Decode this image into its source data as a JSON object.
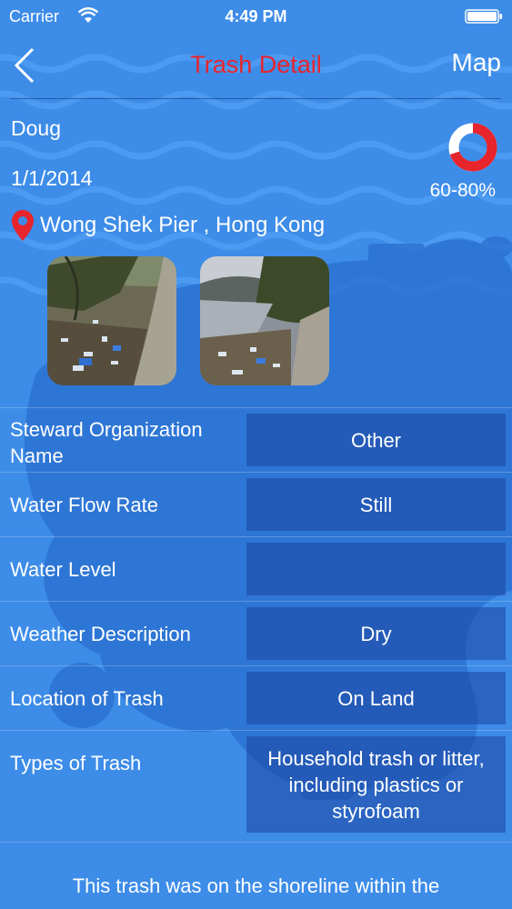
{
  "status_bar": {
    "carrier": "Carrier",
    "time": "4:49 PM"
  },
  "nav": {
    "title": "Trash Detail",
    "map_label": "Map"
  },
  "report": {
    "user": "Doug",
    "date": "1/1/2014",
    "location": "Wong Shek Pier , Hong Kong",
    "coverage_label": "60-80%",
    "coverage_fraction": 0.7
  },
  "details": [
    {
      "label": "Steward Organization Name",
      "value": "Other"
    },
    {
      "label": "Water Flow Rate",
      "value": "Still"
    },
    {
      "label": "Water Level",
      "value": ""
    },
    {
      "label": "Weather Description",
      "value": "Dry"
    },
    {
      "label": "Location of Trash",
      "value": "On Land"
    },
    {
      "label": "Types of Trash",
      "value": "Household trash or litter, including plastics or styrofoam"
    }
  ],
  "description": "This trash was on the shoreline within the",
  "icons": [
    "back-chevron-icon",
    "wifi-icon",
    "battery-icon",
    "location-pin-icon",
    "coverage-gauge-icon"
  ],
  "colors": {
    "background": "#3d8ce8",
    "title": "#e8242c",
    "gauge": "#e8242c",
    "value_box": "#2f5fb4"
  }
}
